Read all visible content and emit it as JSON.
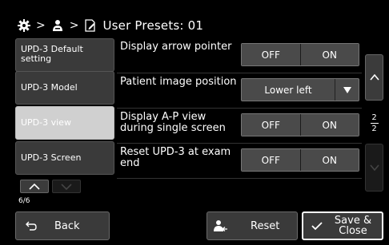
{
  "titlebar": {
    "separator": ">",
    "title": "User Presets: 01",
    "icons": [
      "gear-icon",
      "user-icon",
      "document-edit-icon"
    ]
  },
  "sidebar": {
    "items": [
      {
        "label": "UPD-3 Default setting",
        "active": false
      },
      {
        "label": "UPD-3 Model",
        "active": false
      },
      {
        "label": "UPD-3 view",
        "active": true
      },
      {
        "label": "UPD-3 Screen",
        "active": false
      }
    ],
    "page_counter": "6/6"
  },
  "settings": [
    {
      "label": "Display arrow pointer",
      "type": "toggle",
      "options": [
        "OFF",
        "ON"
      ]
    },
    {
      "label": "Patient image position",
      "type": "select",
      "value": "Lower left"
    },
    {
      "label": "Display A-P view during single screen",
      "type": "toggle",
      "options": [
        "OFF",
        "ON"
      ]
    },
    {
      "label": "Reset UPD-3 at exam end",
      "type": "toggle",
      "options": [
        "OFF",
        "ON"
      ]
    }
  ],
  "scroller": {
    "page_current": "2",
    "page_total": "2"
  },
  "footer": {
    "back_label": "Back",
    "reset_label": "Reset",
    "save_label": "Save & Close"
  },
  "colors": {
    "background": "#000000",
    "button": "#4a4a4a",
    "active_nav": "#d0d0d0"
  }
}
